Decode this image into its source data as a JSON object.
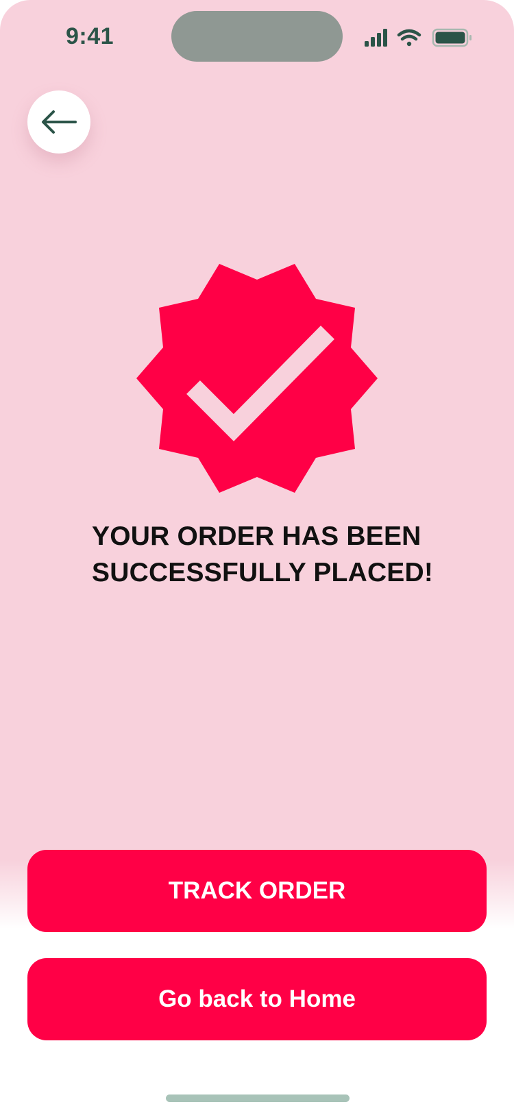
{
  "status_bar": {
    "time": "9:41",
    "icons": [
      "signal-icon",
      "wifi-icon",
      "battery-icon"
    ]
  },
  "header": {
    "back_icon": "arrow-left-icon"
  },
  "confirmation": {
    "badge_icon": "verified-badge-check-icon",
    "title_line1": "YOUR ORDER HAS BEEN",
    "title_line2": "SUCCESSFULLY PLACED!"
  },
  "actions": {
    "track_order_label": "TRACK ORDER",
    "go_home_label": "Go back to Home"
  },
  "colors": {
    "background": "#f8d1dc",
    "accent": "#ff0046",
    "icon_dark_green": "#2b5448",
    "text": "#111111"
  }
}
